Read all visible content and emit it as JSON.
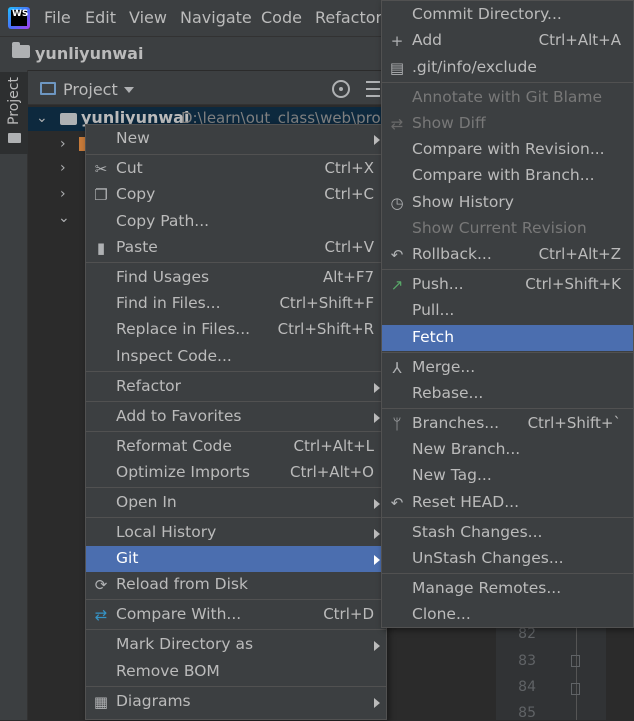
{
  "menubar": {
    "logo_text": "WS",
    "items": [
      "File",
      "Edit",
      "View",
      "Navigate",
      "Code",
      "Refactor"
    ]
  },
  "project": {
    "title": "yunliyunwai",
    "tool_window_label": "Project",
    "view_label": "Project",
    "root_name": "yunliyunwai",
    "root_path": "D:\\learn\\out_class\\web\\proj"
  },
  "editor": {
    "line_numbers": [
      "82",
      "83",
      "84",
      "85"
    ]
  },
  "context_menu": {
    "items": [
      {
        "label": "New",
        "shortcut": "",
        "submenu": true,
        "icon": ""
      },
      {
        "label": "Cut",
        "shortcut": "Ctrl+X",
        "submenu": false,
        "icon": "scissors-icon"
      },
      {
        "label": "Copy",
        "shortcut": "Ctrl+C",
        "submenu": false,
        "icon": "copy-icon"
      },
      {
        "label": "Copy Path...",
        "shortcut": "",
        "submenu": false,
        "icon": ""
      },
      {
        "label": "Paste",
        "shortcut": "Ctrl+V",
        "submenu": false,
        "icon": "clipboard-icon"
      },
      {
        "label": "Find Usages",
        "shortcut": "Alt+F7",
        "submenu": false,
        "icon": ""
      },
      {
        "label": "Find in Files...",
        "shortcut": "Ctrl+Shift+F",
        "submenu": false,
        "icon": ""
      },
      {
        "label": "Replace in Files...",
        "shortcut": "Ctrl+Shift+R",
        "submenu": false,
        "icon": ""
      },
      {
        "label": "Inspect Code...",
        "shortcut": "",
        "submenu": false,
        "icon": ""
      },
      {
        "label": "Refactor",
        "shortcut": "",
        "submenu": true,
        "icon": ""
      },
      {
        "label": "Add to Favorites",
        "shortcut": "",
        "submenu": true,
        "icon": ""
      },
      {
        "label": "Reformat Code",
        "shortcut": "Ctrl+Alt+L",
        "submenu": false,
        "icon": ""
      },
      {
        "label": "Optimize Imports",
        "shortcut": "Ctrl+Alt+O",
        "submenu": false,
        "icon": ""
      },
      {
        "label": "Open In",
        "shortcut": "",
        "submenu": true,
        "icon": ""
      },
      {
        "label": "Local History",
        "shortcut": "",
        "submenu": true,
        "icon": ""
      },
      {
        "label": "Git",
        "shortcut": "",
        "submenu": true,
        "icon": "",
        "selected": true
      },
      {
        "label": "Reload from Disk",
        "shortcut": "",
        "submenu": false,
        "icon": "reload-icon"
      },
      {
        "label": "Compare With...",
        "shortcut": "Ctrl+D",
        "submenu": false,
        "icon": "compare-arrows-icon"
      },
      {
        "label": "Mark Directory as",
        "shortcut": "",
        "submenu": true,
        "icon": ""
      },
      {
        "label": "Remove BOM",
        "shortcut": "",
        "submenu": false,
        "icon": ""
      },
      {
        "label": "Diagrams",
        "shortcut": "",
        "submenu": true,
        "icon": "diagram-icon"
      }
    ]
  },
  "git_menu": {
    "items": [
      {
        "label": "Commit Directory...",
        "shortcut": "",
        "icon": ""
      },
      {
        "label": "Add",
        "shortcut": "Ctrl+Alt+A",
        "icon": "plus-icon"
      },
      {
        "label": ".git/info/exclude",
        "shortcut": "",
        "icon": "file-icon"
      },
      {
        "label": "Annotate with Git Blame",
        "shortcut": "",
        "icon": "",
        "disabled": true
      },
      {
        "label": "Show Diff",
        "shortcut": "",
        "icon": "diff-arrows-icon",
        "disabled": true
      },
      {
        "label": "Compare with Revision...",
        "shortcut": "",
        "icon": ""
      },
      {
        "label": "Compare with Branch...",
        "shortcut": "",
        "icon": ""
      },
      {
        "label": "Show History",
        "shortcut": "",
        "icon": "clock-icon"
      },
      {
        "label": "Show Current Revision",
        "shortcut": "",
        "icon": "",
        "disabled": true
      },
      {
        "label": "Rollback...",
        "shortcut": "Ctrl+Alt+Z",
        "icon": "undo-icon"
      },
      {
        "label": "Push...",
        "shortcut": "Ctrl+Shift+K",
        "icon": "push-arrow-icon"
      },
      {
        "label": "Pull...",
        "shortcut": "",
        "icon": ""
      },
      {
        "label": "Fetch",
        "shortcut": "",
        "icon": "",
        "selected": true
      },
      {
        "label": "Merge...",
        "shortcut": "",
        "icon": "merge-icon"
      },
      {
        "label": "Rebase...",
        "shortcut": "",
        "icon": ""
      },
      {
        "label": "Branches...",
        "shortcut": "Ctrl+Shift+`",
        "icon": "branch-icon"
      },
      {
        "label": "New Branch...",
        "shortcut": "",
        "icon": ""
      },
      {
        "label": "New Tag...",
        "shortcut": "",
        "icon": ""
      },
      {
        "label": "Reset HEAD...",
        "shortcut": "",
        "icon": "undo-icon"
      },
      {
        "label": "Stash Changes...",
        "shortcut": "",
        "icon": ""
      },
      {
        "label": "UnStash Changes...",
        "shortcut": "",
        "icon": ""
      },
      {
        "label": "Manage Remotes...",
        "shortcut": "",
        "icon": ""
      },
      {
        "label": "Clone...",
        "shortcut": "",
        "icon": ""
      }
    ]
  },
  "colors": {
    "selection": "#4b6eaf",
    "menu_bg": "#3c3f41",
    "push_icon": "#59a869",
    "compare_icon": "#3592c4"
  }
}
